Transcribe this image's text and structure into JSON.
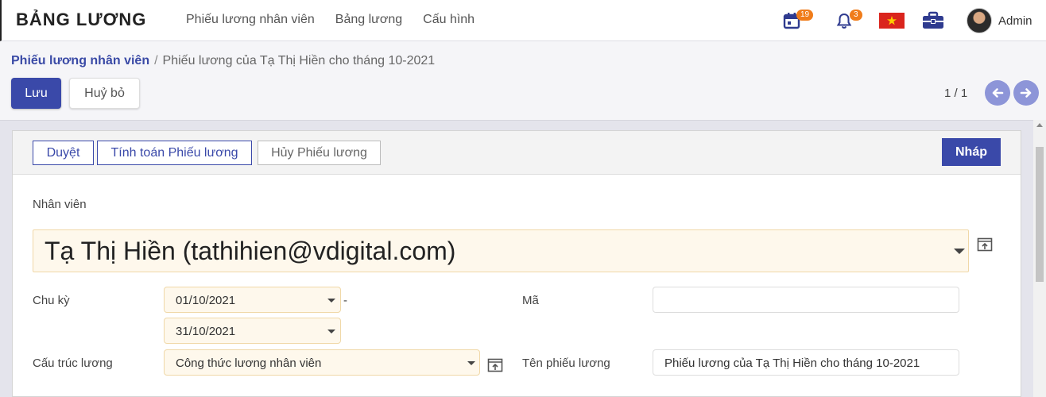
{
  "navbar": {
    "brand": "BẢNG LƯƠNG",
    "menu": [
      "Phiếu lương nhân viên",
      "Bảng lương",
      "Cấu hình"
    ],
    "calendar_badge": "19",
    "notification_badge": "3",
    "user_name": "Admin",
    "icons": [
      "calendar-icon",
      "bell-icon",
      "vietnam-flag-icon",
      "briefcase-icon",
      "avatar"
    ]
  },
  "breadcrumb": {
    "parent": "Phiếu lương nhân viên",
    "separator": "/",
    "current": "Phiếu lương của Tạ Thị Hiền cho tháng 10-2021"
  },
  "actions": {
    "save": "Lưu",
    "cancel": "Huỷ bỏ"
  },
  "pager": {
    "value": "1 / 1"
  },
  "statusbar": {
    "buttons": [
      "Duyệt",
      "Tính toán Phiếu lương",
      "Hủy Phiếu lương"
    ],
    "status": "Nháp"
  },
  "form": {
    "employee_label": "Nhân viên",
    "employee_value": "Tạ Thị Hiền (tathihien@vdigital.com)",
    "period_label": "Chu kỳ",
    "date_from": "01/10/2021",
    "period_sep": "-",
    "date_to": "31/10/2021",
    "structure_label": "Cấu trúc lương",
    "structure_value": "Công thức lương nhân viên",
    "code_label": "Mã",
    "code_value": "",
    "name_label": "Tên phiếu lương",
    "name_value": "Phiếu lương của Tạ Thị Hiền cho tháng 10-2021"
  },
  "colors": {
    "primary": "#3a49a9",
    "badge": "#f07c1a",
    "required_bg": "#fef8ec"
  }
}
